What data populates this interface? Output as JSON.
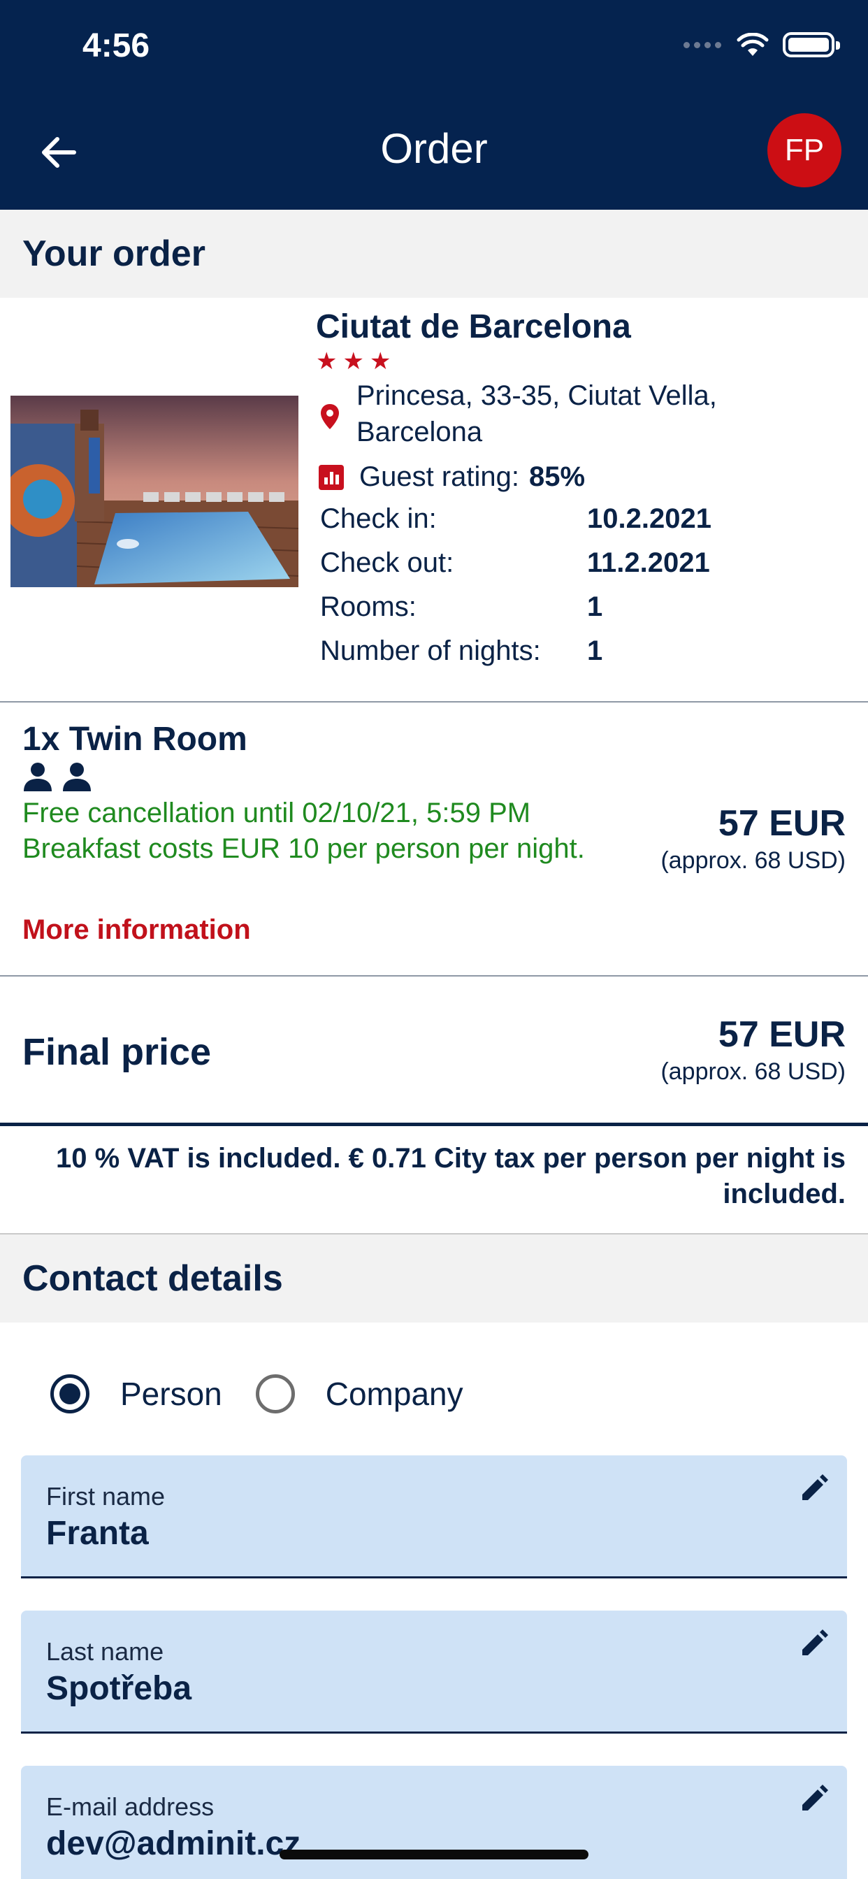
{
  "status_bar": {
    "time": "4:56"
  },
  "app_bar": {
    "title": "Order",
    "avatar_initials": "FP"
  },
  "order_section": {
    "heading": "Your order"
  },
  "hotel": {
    "name": "Ciutat de Barcelona",
    "star_count": 3,
    "address": "Princesa, 33-35, Ciutat Vella, Barcelona",
    "rating_label": "Guest rating:",
    "rating_value": "85%",
    "details": [
      {
        "label": "Check in:",
        "value": "10.2.2021"
      },
      {
        "label": "Check out:",
        "value": "11.2.2021"
      },
      {
        "label": "Rooms:",
        "value": "1"
      },
      {
        "label": "Number of nights:",
        "value": "1"
      }
    ]
  },
  "room": {
    "title": "1x Twin Room",
    "person_count": 2,
    "cancellation": "Free cancellation until 02/10/21, 5:59 PM",
    "breakfast": "Breakfast costs EUR 10 per person per night.",
    "more_info": "More information",
    "price": "57 EUR",
    "price_approx": "(approx. 68 USD)"
  },
  "final": {
    "label": "Final price",
    "price": "57 EUR",
    "price_approx": "(approx. 68 USD)"
  },
  "tax_note": "10 % VAT is included. € 0.71 City tax per person per night is included.",
  "contact": {
    "heading": "Contact details",
    "radio_person": "Person",
    "radio_company": "Company",
    "selected": "Person",
    "fields": [
      {
        "label": "First name",
        "value": "Franta"
      },
      {
        "label": "Last name",
        "value": "Spotřeba"
      },
      {
        "label": "E-mail address",
        "value": "dev@adminit.cz"
      }
    ]
  },
  "colors": {
    "primary": "#05234f",
    "accent": "#cc0e14",
    "success": "#1f8a1f",
    "field_background": "#cfe2f6"
  },
  "icons": [
    "back-arrow-icon",
    "location-pin-icon",
    "rating-chart-icon",
    "person-icon",
    "edit-pencil-icon",
    "wifi-icon",
    "battery-icon"
  ]
}
